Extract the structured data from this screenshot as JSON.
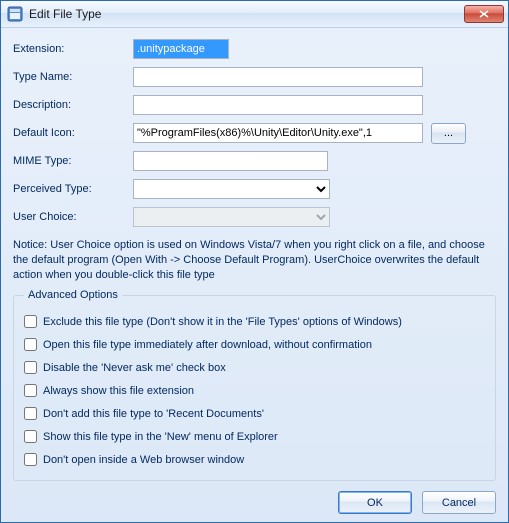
{
  "titlebar": {
    "title": "Edit File Type"
  },
  "labels": {
    "extension": "Extension:",
    "type_name": "Type Name:",
    "description": "Description:",
    "default_icon": "Default Icon:",
    "mime_type": "MIME Type:",
    "perceived_type": "Perceived Type:",
    "user_choice": "User Choice:"
  },
  "values": {
    "extension": ".unitypackage",
    "type_name": "",
    "description": "",
    "default_icon": "\"%ProgramFiles(x86)%\\Unity\\Editor\\Unity.exe\",1",
    "mime_type": "",
    "perceived_type": "",
    "user_choice": ""
  },
  "browse_label": "...",
  "notice": "Notice: User Choice option is used on Windows Vista/7 when you right click on a file, and choose the default program (Open With -> Choose Default Program). UserChoice overwrites the default action when you double-click this file type",
  "advanced": {
    "legend": "Advanced Options",
    "items": [
      "Exclude  this file type (Don't show it in the 'File Types' options of Windows)",
      "Open this file type immediately after download, without confirmation",
      "Disable the 'Never ask me' check box",
      "Always show this file extension",
      "Don't add this file type to 'Recent Documents'",
      "Show this file type in the 'New' menu of Explorer",
      "Don't open inside a Web browser window"
    ]
  },
  "buttons": {
    "ok": "OK",
    "cancel": "Cancel"
  }
}
